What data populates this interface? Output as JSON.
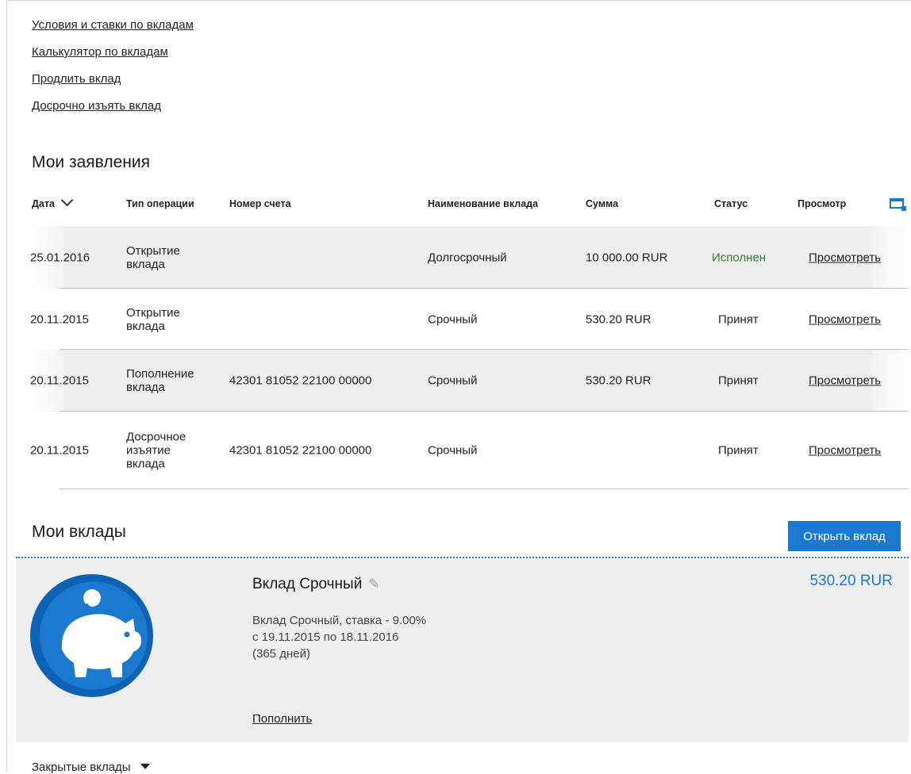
{
  "links": {
    "conditions": "Условия и ставки по вкладам",
    "calculator": "Калькулятор по вкладам",
    "extend": "Продлить вклад",
    "withdraw_early": "Досрочно изъять вклад"
  },
  "applications": {
    "title": "Мои заявления",
    "columns": {
      "date": "Дата",
      "type": "Тип операции",
      "account": "Номер счета",
      "deposit_name": "Наименование вклада",
      "amount": "Сумма",
      "status": "Статус",
      "view": "Просмотр"
    },
    "rows": [
      {
        "date": "25.01.2016",
        "type": "Открытие вклада",
        "account": "",
        "deposit_name": "Долгосрочный",
        "amount": "10 000.00 RUR",
        "status": "Исполнен",
        "view": "Просмотреть"
      },
      {
        "date": "20.11.2015",
        "type": "Открытие вклада",
        "account": "",
        "deposit_name": "Срочный",
        "amount": "530.20 RUR",
        "status": "Принят",
        "view": "Просмотреть"
      },
      {
        "date": "20.11.2015",
        "type": "Пополнение вклада",
        "account": "42301 81052 22100 00000",
        "deposit_name": "Срочный",
        "amount": "530.20 RUR",
        "status": "Принят",
        "view": "Просмотреть"
      },
      {
        "date": "20.11.2015",
        "type": "Досрочное изъятие вклада",
        "account": "42301 81052 22100 00000",
        "deposit_name": "Срочный",
        "amount": "",
        "status": "Принят",
        "view": "Просмотреть"
      }
    ]
  },
  "deposits": {
    "title": "Мои вклады",
    "open_button": "Открыть вклад",
    "card": {
      "icon": "piggy-bank-icon",
      "name": "Вклад Срочный",
      "amount": "530.20 RUR",
      "desc_line1": "Вклад Срочный, ставка - 9.00%",
      "desc_line2": "с 19.11.2015 по 18.11.2016",
      "desc_line3": "(365 дней)",
      "topup": "Пополнить"
    }
  },
  "closed_deposits": "Закрытые вклады",
  "colors": {
    "accent": "#1b7ad0",
    "success": "#2e7d32",
    "card_bg": "#eeeeee"
  }
}
